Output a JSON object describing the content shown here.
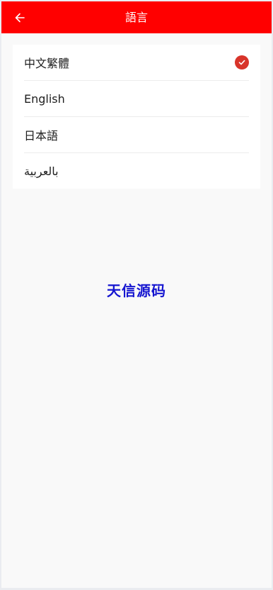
{
  "header": {
    "back_icon": "arrow-left-icon",
    "title": "語言"
  },
  "languages": [
    {
      "label": "中文繁體",
      "selected": true
    },
    {
      "label": "English",
      "selected": false
    },
    {
      "label": "日本語",
      "selected": false
    },
    {
      "label": "بالعربية",
      "selected": false
    }
  ],
  "selected_icon": "check-circle-icon",
  "watermark": "天信源码",
  "colors": {
    "header_bg": "#ff0000",
    "check": "#d8342a",
    "watermark": "#1616d0",
    "page_bg": "#f9f9f9"
  }
}
